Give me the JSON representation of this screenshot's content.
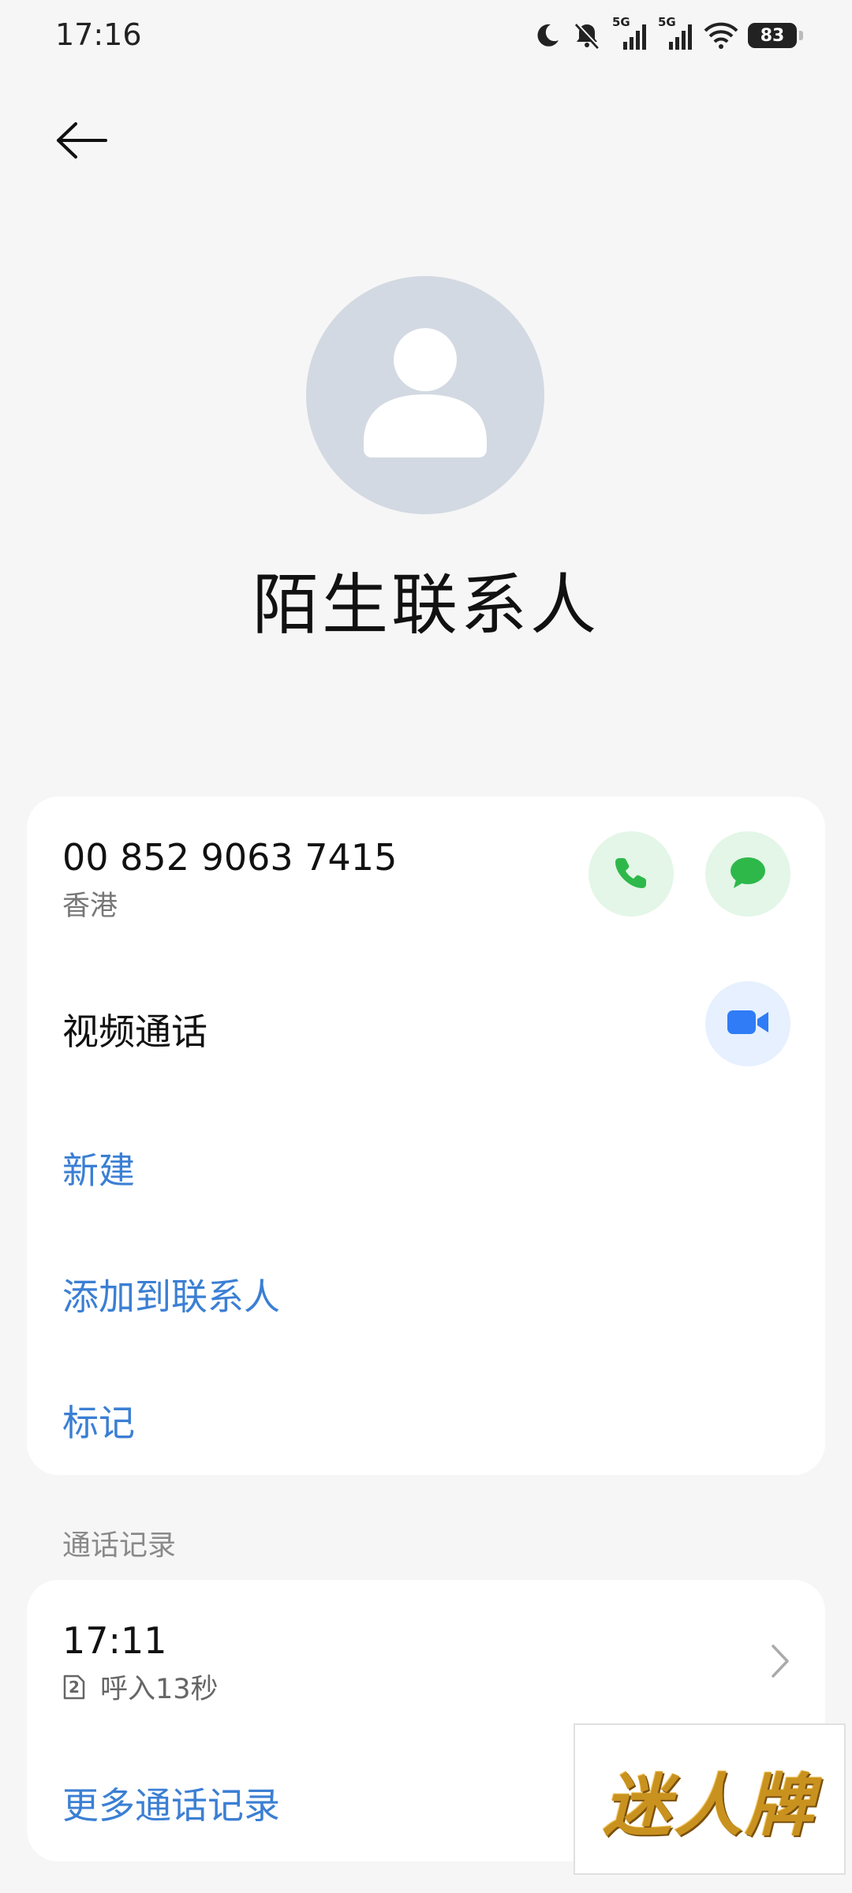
{
  "status_bar": {
    "time": "17:16",
    "battery": "83",
    "network_1": "5G",
    "network_2": "5G"
  },
  "contact": {
    "name": "陌生联系人",
    "phone_number": "00 852 9063 7415",
    "region": "香港"
  },
  "actions": {
    "video_call": "视频通话",
    "new": "新建",
    "add_to_contacts": "添加到联系人",
    "mark": "标记"
  },
  "call_log": {
    "section_title": "通话记录",
    "entries": [
      {
        "time": "17:11",
        "sim": "2",
        "detail": "呼入13秒"
      }
    ],
    "more_label": "更多通话记录"
  },
  "watermark": {
    "text": "迷人牌"
  },
  "colors": {
    "accent_blue": "#3b7fd4",
    "call_green": "#2eb84a",
    "video_blue": "#2f7cf6",
    "avatar_bg": "#d3d9e2"
  },
  "icons": {
    "back": "arrow-left-icon",
    "call": "phone-icon",
    "message": "message-bubble-icon",
    "video": "video-camera-icon",
    "chevron": "chevron-right-icon"
  }
}
